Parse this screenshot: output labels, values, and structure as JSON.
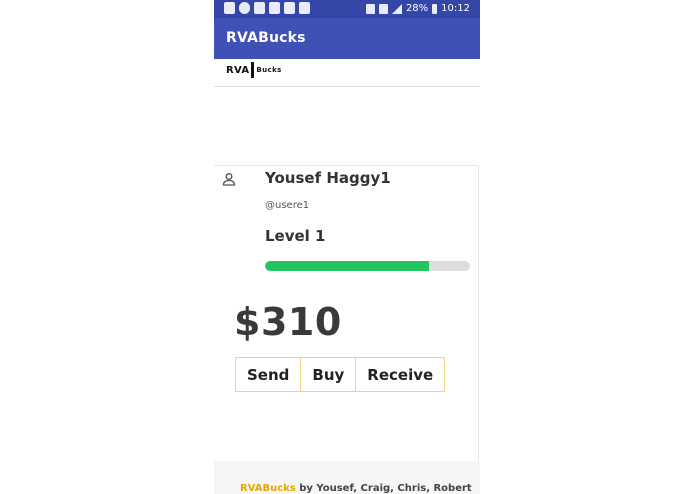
{
  "status_bar": {
    "battery_percent": "28%",
    "time": "10:12"
  },
  "app_bar": {
    "title": "RVABucks"
  },
  "logo": {
    "left_text": "RVA",
    "right_text": "Bucks"
  },
  "profile": {
    "name": "Yousef Haggy1",
    "handle": "@usere1",
    "level": "Level 1",
    "progress_fraction": 0.8
  },
  "wallet": {
    "balance": "$310"
  },
  "actions": {
    "send_label": "Send",
    "buy_label": "Buy",
    "receive_label": "Receive"
  },
  "footer": {
    "brand": "RVABucks",
    "credits": " by Yousef, Craig, Chris, Robert"
  },
  "colors": {
    "app_bar": "#3f51b5",
    "status_bar": "#3446a8",
    "progress": "#22c55e",
    "accent_border": "#f0d27a",
    "footer_brand": "#e3a800"
  }
}
